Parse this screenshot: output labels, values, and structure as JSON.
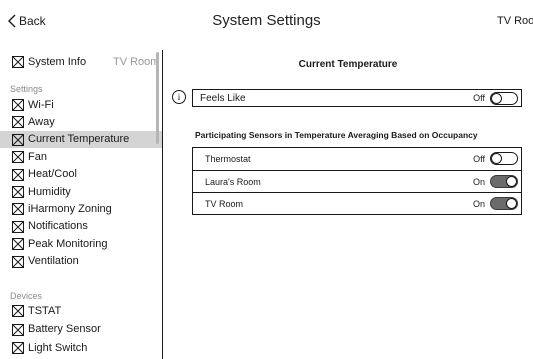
{
  "header": {
    "back_label": "Back",
    "title": "System Settings",
    "room_label": "TV Roo"
  },
  "sidebar": {
    "top_item": {
      "label": "System Info",
      "room": "TV Room"
    },
    "settings_label": "Settings",
    "settings_items": [
      {
        "label": "Wi-Fi",
        "selected": false
      },
      {
        "label": "Away",
        "selected": false
      },
      {
        "label": "Current Temperature",
        "selected": true
      },
      {
        "label": "Fan",
        "selected": false
      },
      {
        "label": "Heat/Cool",
        "selected": false
      },
      {
        "label": "Humidity",
        "selected": false
      },
      {
        "label": "iHarmony Zoning",
        "selected": false
      },
      {
        "label": "Notifications",
        "selected": false
      },
      {
        "label": "Peak Monitoring",
        "selected": false
      },
      {
        "label": "Ventilation",
        "selected": false
      }
    ],
    "devices_label": "Devices",
    "device_items": [
      {
        "label": "TSTAT"
      },
      {
        "label": "Battery Sensor"
      },
      {
        "label": "Light Switch"
      }
    ]
  },
  "main": {
    "title": "Current Temperature",
    "feels_like": {
      "label": "Feels Like",
      "state": "Off",
      "on": false
    },
    "sensors_heading": "Participating Sensors in Temperature Averaging Based on Occupancy",
    "sensors": [
      {
        "label": "Thermostat",
        "state": "Off",
        "on": false
      },
      {
        "label": "Laura's Room",
        "state": "On",
        "on": true
      },
      {
        "label": "TV Room",
        "state": "On",
        "on": true
      }
    ]
  },
  "colors": {
    "selected_bg": "#d4d4d4",
    "toggle_on": "#6b6b6b",
    "muted_text": "#999999"
  }
}
